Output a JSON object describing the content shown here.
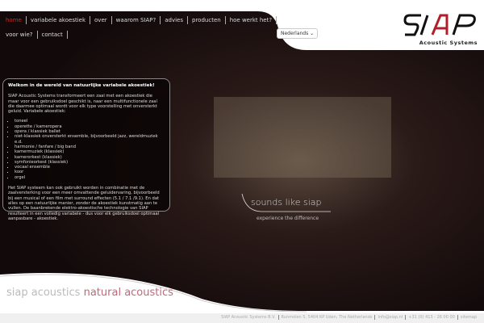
{
  "nav": {
    "row1": [
      {
        "label": "home",
        "active": true
      },
      {
        "label": "variabele akoestiek"
      },
      {
        "label": "over"
      },
      {
        "label": "waarom SIAP?"
      },
      {
        "label": "advies"
      },
      {
        "label": "producten"
      },
      {
        "label": "hoe werkt het?"
      }
    ],
    "row2": [
      {
        "label": "voor wie?"
      },
      {
        "label": "contact"
      }
    ]
  },
  "language": {
    "selected": "Nederlands"
  },
  "logo": {
    "text": "SIAP",
    "subtitle": "Acoustic Systems"
  },
  "panel": {
    "title": "Welkom in de wereld van natuurlijke variabele akoestiek!",
    "intro": "SIAP Acoustic Systems transformeert een zaal met een akoestiek die maar voor een gebruiksdoel geschikt is, naar een multifunctionele zaal die daarmee optimaal wordt voor elk type voorstelling met onversterkt geluid. Variabele akoestiek:",
    "items": [
      "toneel",
      "operette / kameropera",
      "opera / klassiek ballet",
      "niet-klassiek onversterkt ensemble, bijvoorbeeld jazz, wereldmuziek e.d.",
      "harmonie / fanfare / big band",
      "kamermuziek (klassiek)",
      "kamerorkest (klassiek)",
      "symfonieorkest (klassiek)",
      "vocaal ensemble",
      "koor",
      "orgel"
    ],
    "outro": "Het SIAP systeem kan ook gebruikt worden in combinatie met de zaalversterking voor een meer omvattende geluidervaring, bijvoorbeeld bij een musical of een film met surround effecten (5.1 / 7.1 /9.1). En dat alles op een natuurlijke manier, zonder de akoestiek kunstmatig aan te vullen. De baanbrekende elektro-akoestische technologie van SIAP resulteert in een volledig variabele - dus voor elk gebruiksdoel optimaal aanpasbare - akoestiek."
  },
  "slogan": "sounds like siap",
  "tagline": "experience the difference",
  "bottom": {
    "a": "siap acoustics",
    "b": "natural acoustics"
  },
  "footer": [
    "SIAP Acoustic Systems B.V.",
    "Runmolen 5, 5404 KP Uden, The Netherlands",
    "info@siap.nl",
    "+31 (0) 413 - 26 00 00",
    "sitemap"
  ]
}
